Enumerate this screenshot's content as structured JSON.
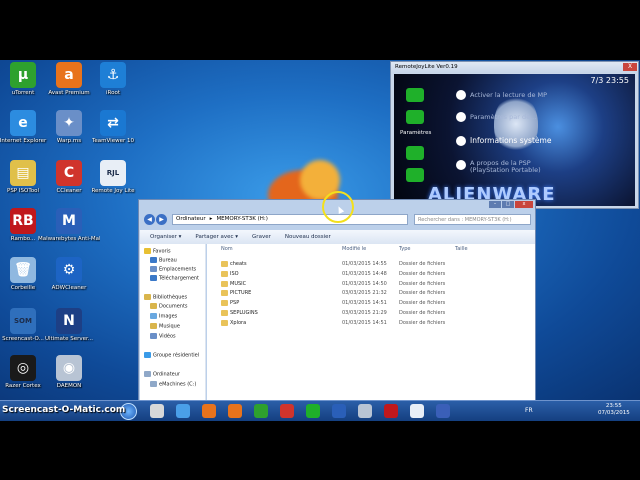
{
  "desktop_icons": [
    {
      "label": "uTorrent",
      "color": "#2ea12e",
      "glyph": "µ"
    },
    {
      "label": "Avast Premium",
      "color": "#e8731c",
      "glyph": "a"
    },
    {
      "label": "iRoot",
      "color": "#1e7fd6",
      "glyph": "⚓"
    },
    {
      "label": "Internet Explorer",
      "color": "#2c8ce0",
      "glyph": "e"
    },
    {
      "label": "Warp.ms",
      "color": "#6a8fc8",
      "glyph": "✦"
    },
    {
      "label": "TeamViewer 10",
      "color": "#1a78d2",
      "glyph": "⇄"
    },
    {
      "label": "PSP ISOTool",
      "color": "#e0c04a",
      "glyph": "▤"
    },
    {
      "label": "CCleaner",
      "color": "#d0342c",
      "glyph": "C"
    },
    {
      "label": "Remote Joy Lite",
      "color": "#e8eef6",
      "glyph": "RJL"
    },
    {
      "label": "Rambo...",
      "color": "#c0181c",
      "glyph": "RB"
    },
    {
      "label": "Malwarebytes Anti-Malware",
      "color": "#2a5fb8",
      "glyph": "M"
    },
    {
      "label": "Corbeille",
      "color": "#8fb8e0",
      "glyph": "🗑"
    },
    {
      "label": "ADWCleaner",
      "color": "#1d64c4",
      "glyph": "⚙"
    },
    {
      "label": "Screencast-O...",
      "color": "#2f6fbc",
      "glyph": "SOM"
    },
    {
      "label": "Ultimate Server...",
      "color": "#1d3f85",
      "glyph": "N"
    },
    {
      "label": "Razer Cortex",
      "color": "#1a1a1a",
      "glyph": "◎"
    },
    {
      "label": "DAEMON",
      "color": "#b8c4d4",
      "glyph": "◉"
    }
  ],
  "remote_joy": {
    "title": "RemoteJoyLite Ver0.19",
    "close": "X",
    "clock": "7/3 23:55",
    "section_label": "Paramètres",
    "menu": [
      "Activer la lecture de MP",
      "Paramètres par dé...",
      "Informations système",
      "A propos de la PSP (PlayStation Portable)"
    ],
    "brand": "ALIENWARE"
  },
  "explorer": {
    "controls": [
      "–",
      "□",
      "x"
    ],
    "back": "◀",
    "forward": "▶",
    "breadcrumb": [
      "Ordinateur",
      "MEMORY-ST3K (H:)"
    ],
    "search_placeholder": "Rechercher dans : MEMORY-ST3K (H:)",
    "toolbar": [
      "Organiser ▾",
      "Partager avec ▾",
      "Graver",
      "Nouveau dossier"
    ],
    "nav": [
      {
        "label": "Favoris",
        "color": "#e8c032"
      },
      {
        "label": "Bureau",
        "color": "#3a78c8"
      },
      {
        "label": "Emplacements",
        "color": "#6a8fc8"
      },
      {
        "label": "Téléchargement",
        "color": "#3a78c8"
      },
      {
        "label": "Bibliothèques",
        "color": "#d9b54c"
      },
      {
        "label": "Documents",
        "color": "#d9b54c"
      },
      {
        "label": "Images",
        "color": "#6aa8e0"
      },
      {
        "label": "Musique",
        "color": "#d9b54c"
      },
      {
        "label": "Vidéos",
        "color": "#6a8fc8"
      },
      {
        "label": "Groupe résidentiel",
        "color": "#3a9be8"
      },
      {
        "label": "Ordinateur",
        "color": "#8fa8c8"
      },
      {
        "label": "eMachines (C:)",
        "color": "#8fa8c8"
      }
    ],
    "columns": {
      "name": "Nom",
      "date": "Modifié le",
      "type": "Type",
      "size": "Taille"
    },
    "files": [
      {
        "name": "cheats",
        "date": "01/03/2015 14:55",
        "type": "Dossier de fichiers"
      },
      {
        "name": "ISO",
        "date": "01/03/2015 14:48",
        "type": "Dossier de fichiers"
      },
      {
        "name": "MUSIC",
        "date": "01/03/2015 14:50",
        "type": "Dossier de fichiers"
      },
      {
        "name": "PICTURE",
        "date": "03/03/2015 21:32",
        "type": "Dossier de fichiers"
      },
      {
        "name": "PSP",
        "date": "01/03/2015 14:51",
        "type": "Dossier de fichiers"
      },
      {
        "name": "SEPLUGINS",
        "date": "03/03/2015 21:29",
        "type": "Dossier de fichiers"
      },
      {
        "name": "Xplora",
        "date": "01/03/2015 14:51",
        "type": "Dossier de fichiers"
      }
    ]
  },
  "taskbar": {
    "watermark": "Screencast-O-Matic.com",
    "language": "FR",
    "time": "23:55",
    "date": "07/03/2015",
    "colors": [
      "#d8d8d8",
      "#4a9fe8",
      "#e8731c",
      "#e8731c",
      "#2ea12e",
      "#d0342c",
      "#1fb02a",
      "#2a5fb8",
      "#b8c4d4",
      "#c0181c",
      "#e8eef6",
      "#3a5fb8"
    ]
  }
}
